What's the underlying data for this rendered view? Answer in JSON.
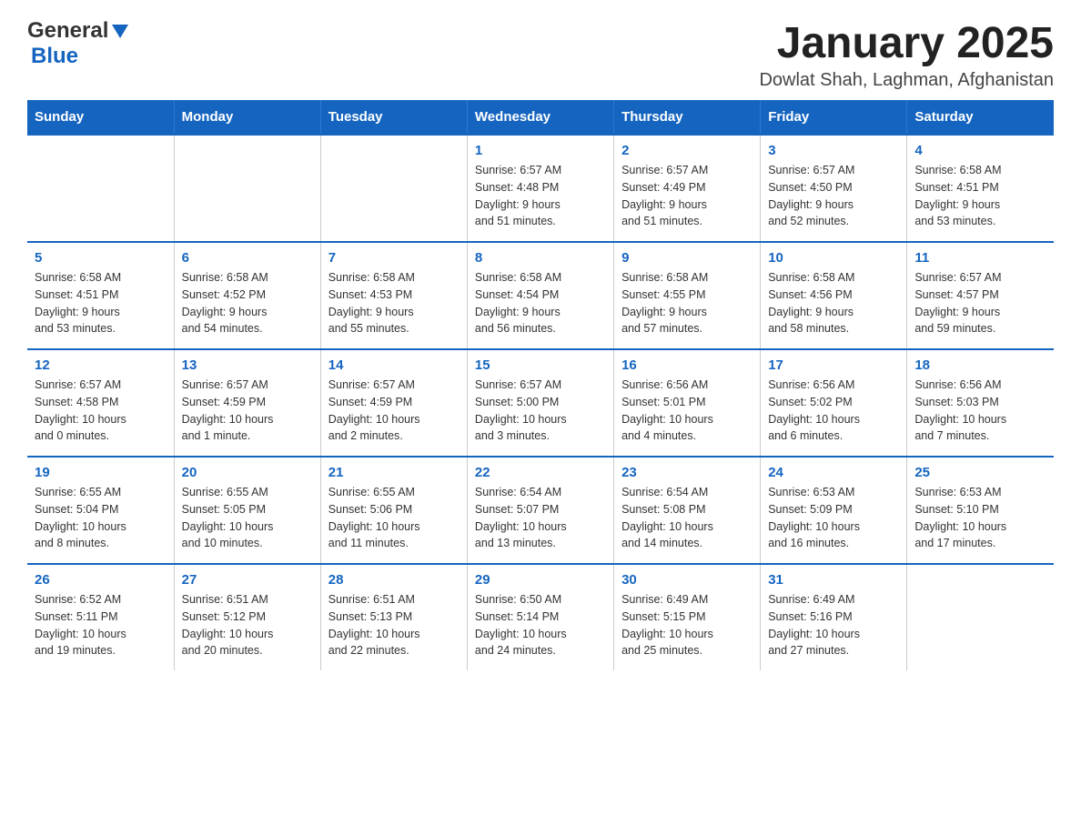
{
  "header": {
    "logo_general": "General",
    "logo_blue": "Blue",
    "title": "January 2025",
    "subtitle": "Dowlat Shah, Laghman, Afghanistan"
  },
  "days_of_week": [
    "Sunday",
    "Monday",
    "Tuesday",
    "Wednesday",
    "Thursday",
    "Friday",
    "Saturday"
  ],
  "weeks": [
    {
      "cells": [
        {
          "day": "",
          "info": ""
        },
        {
          "day": "",
          "info": ""
        },
        {
          "day": "",
          "info": ""
        },
        {
          "day": "1",
          "info": "Sunrise: 6:57 AM\nSunset: 4:48 PM\nDaylight: 9 hours\nand 51 minutes."
        },
        {
          "day": "2",
          "info": "Sunrise: 6:57 AM\nSunset: 4:49 PM\nDaylight: 9 hours\nand 51 minutes."
        },
        {
          "day": "3",
          "info": "Sunrise: 6:57 AM\nSunset: 4:50 PM\nDaylight: 9 hours\nand 52 minutes."
        },
        {
          "day": "4",
          "info": "Sunrise: 6:58 AM\nSunset: 4:51 PM\nDaylight: 9 hours\nand 53 minutes."
        }
      ]
    },
    {
      "cells": [
        {
          "day": "5",
          "info": "Sunrise: 6:58 AM\nSunset: 4:51 PM\nDaylight: 9 hours\nand 53 minutes."
        },
        {
          "day": "6",
          "info": "Sunrise: 6:58 AM\nSunset: 4:52 PM\nDaylight: 9 hours\nand 54 minutes."
        },
        {
          "day": "7",
          "info": "Sunrise: 6:58 AM\nSunset: 4:53 PM\nDaylight: 9 hours\nand 55 minutes."
        },
        {
          "day": "8",
          "info": "Sunrise: 6:58 AM\nSunset: 4:54 PM\nDaylight: 9 hours\nand 56 minutes."
        },
        {
          "day": "9",
          "info": "Sunrise: 6:58 AM\nSunset: 4:55 PM\nDaylight: 9 hours\nand 57 minutes."
        },
        {
          "day": "10",
          "info": "Sunrise: 6:58 AM\nSunset: 4:56 PM\nDaylight: 9 hours\nand 58 minutes."
        },
        {
          "day": "11",
          "info": "Sunrise: 6:57 AM\nSunset: 4:57 PM\nDaylight: 9 hours\nand 59 minutes."
        }
      ]
    },
    {
      "cells": [
        {
          "day": "12",
          "info": "Sunrise: 6:57 AM\nSunset: 4:58 PM\nDaylight: 10 hours\nand 0 minutes."
        },
        {
          "day": "13",
          "info": "Sunrise: 6:57 AM\nSunset: 4:59 PM\nDaylight: 10 hours\nand 1 minute."
        },
        {
          "day": "14",
          "info": "Sunrise: 6:57 AM\nSunset: 4:59 PM\nDaylight: 10 hours\nand 2 minutes."
        },
        {
          "day": "15",
          "info": "Sunrise: 6:57 AM\nSunset: 5:00 PM\nDaylight: 10 hours\nand 3 minutes."
        },
        {
          "day": "16",
          "info": "Sunrise: 6:56 AM\nSunset: 5:01 PM\nDaylight: 10 hours\nand 4 minutes."
        },
        {
          "day": "17",
          "info": "Sunrise: 6:56 AM\nSunset: 5:02 PM\nDaylight: 10 hours\nand 6 minutes."
        },
        {
          "day": "18",
          "info": "Sunrise: 6:56 AM\nSunset: 5:03 PM\nDaylight: 10 hours\nand 7 minutes."
        }
      ]
    },
    {
      "cells": [
        {
          "day": "19",
          "info": "Sunrise: 6:55 AM\nSunset: 5:04 PM\nDaylight: 10 hours\nand 8 minutes."
        },
        {
          "day": "20",
          "info": "Sunrise: 6:55 AM\nSunset: 5:05 PM\nDaylight: 10 hours\nand 10 minutes."
        },
        {
          "day": "21",
          "info": "Sunrise: 6:55 AM\nSunset: 5:06 PM\nDaylight: 10 hours\nand 11 minutes."
        },
        {
          "day": "22",
          "info": "Sunrise: 6:54 AM\nSunset: 5:07 PM\nDaylight: 10 hours\nand 13 minutes."
        },
        {
          "day": "23",
          "info": "Sunrise: 6:54 AM\nSunset: 5:08 PM\nDaylight: 10 hours\nand 14 minutes."
        },
        {
          "day": "24",
          "info": "Sunrise: 6:53 AM\nSunset: 5:09 PM\nDaylight: 10 hours\nand 16 minutes."
        },
        {
          "day": "25",
          "info": "Sunrise: 6:53 AM\nSunset: 5:10 PM\nDaylight: 10 hours\nand 17 minutes."
        }
      ]
    },
    {
      "cells": [
        {
          "day": "26",
          "info": "Sunrise: 6:52 AM\nSunset: 5:11 PM\nDaylight: 10 hours\nand 19 minutes."
        },
        {
          "day": "27",
          "info": "Sunrise: 6:51 AM\nSunset: 5:12 PM\nDaylight: 10 hours\nand 20 minutes."
        },
        {
          "day": "28",
          "info": "Sunrise: 6:51 AM\nSunset: 5:13 PM\nDaylight: 10 hours\nand 22 minutes."
        },
        {
          "day": "29",
          "info": "Sunrise: 6:50 AM\nSunset: 5:14 PM\nDaylight: 10 hours\nand 24 minutes."
        },
        {
          "day": "30",
          "info": "Sunrise: 6:49 AM\nSunset: 5:15 PM\nDaylight: 10 hours\nand 25 minutes."
        },
        {
          "day": "31",
          "info": "Sunrise: 6:49 AM\nSunset: 5:16 PM\nDaylight: 10 hours\nand 27 minutes."
        },
        {
          "day": "",
          "info": ""
        }
      ]
    }
  ]
}
